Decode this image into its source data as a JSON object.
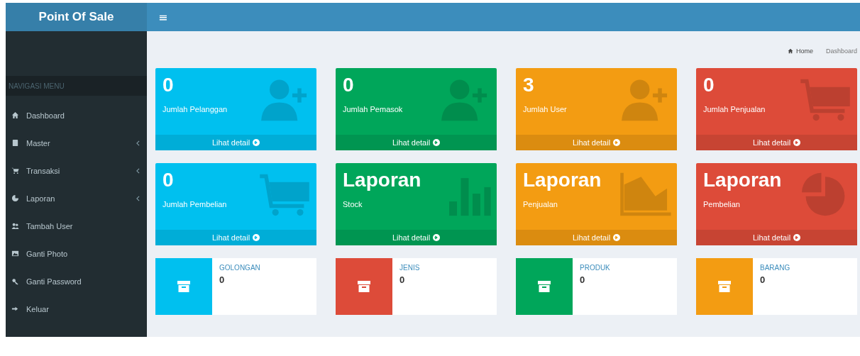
{
  "header": {
    "brand": "Point Of Sale",
    "menu_toggle": "≡"
  },
  "sidebar": {
    "section_header": "NAVIGASI MENU",
    "items": [
      {
        "label": "Dashboard",
        "kind": "home",
        "expandable": false
      },
      {
        "label": "Master",
        "kind": "book",
        "expandable": true
      },
      {
        "label": "Transaksi",
        "kind": "cart",
        "expandable": true
      },
      {
        "label": "Laporan",
        "kind": "pie",
        "expandable": true
      },
      {
        "label": "Tambah User",
        "kind": "users",
        "expandable": false
      },
      {
        "label": "Ganti Photo",
        "kind": "image",
        "expandable": false
      },
      {
        "label": "Ganti Password",
        "kind": "key",
        "expandable": false
      },
      {
        "label": "Keluar",
        "kind": "signout",
        "expandable": false
      }
    ]
  },
  "breadcrumb": [
    {
      "label": "Home",
      "kind": "home"
    },
    {
      "label": "Dashboard",
      "kind": "plain"
    }
  ],
  "stat_boxes": [
    {
      "value": "0",
      "label": "Jumlah Pelanggan",
      "kind": "add-user",
      "color": "#00c0ef",
      "link": "Lihat detail"
    },
    {
      "value": "0",
      "label": "Jumlah Pemasok",
      "kind": "add-user",
      "color": "#00a65a",
      "link": "Lihat detail"
    },
    {
      "value": "3",
      "label": "Jumlah User",
      "kind": "add-user",
      "color": "#f39c12",
      "link": "Lihat detail"
    },
    {
      "value": "0",
      "label": "Jumlah Penjualan",
      "kind": "cart",
      "color": "#dd4b39",
      "link": "Lihat detail"
    },
    {
      "value": "0",
      "label": "Jumlah Pembelian",
      "kind": "cart",
      "color": "#00c0ef",
      "link": "Lihat detail"
    },
    {
      "value": "Laporan",
      "label": "Stock",
      "kind": "bar-chart",
      "color": "#00a65a",
      "link": "Lihat detail"
    },
    {
      "value": "Laporan",
      "label": "Penjualan",
      "kind": "area-chart",
      "color": "#f39c12",
      "link": "Lihat detail"
    },
    {
      "value": "Laporan",
      "label": "Pembelian",
      "kind": "pie-chart",
      "color": "#dd4b39",
      "link": "Lihat detail"
    }
  ],
  "info_boxes": [
    {
      "label": "GOLONGAN",
      "value": "0",
      "color": "#00c0ef"
    },
    {
      "label": "JENIS",
      "value": "0",
      "color": "#dd4b39"
    },
    {
      "label": "PRODUK",
      "value": "0",
      "color": "#00a65a"
    },
    {
      "label": "BARANG",
      "value": "0",
      "color": "#f39c12"
    }
  ]
}
